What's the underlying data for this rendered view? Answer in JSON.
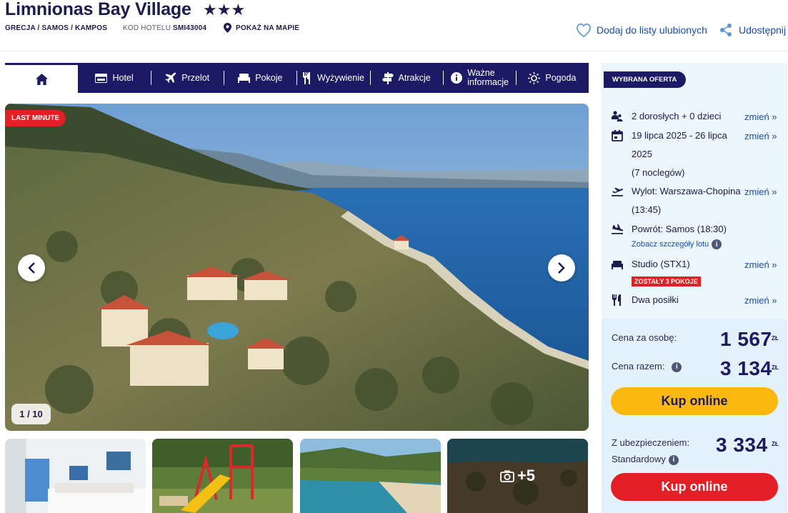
{
  "hotel": {
    "name": "Limnionas Bay Village",
    "stars": "★★★",
    "breadcrumb": "GRECJA / SAMOS / KAMPOS",
    "code_label": "KOD HOTELU",
    "code": "SMI43004",
    "map_link": "POKAŻ NA MAPIE"
  },
  "actions": {
    "favorite": "Dodaj do listy ulubionych",
    "share": "Udostępnij"
  },
  "nav": {
    "items": [
      {
        "label": "Hotel",
        "icon": "hotel-icon"
      },
      {
        "label": "Przelot",
        "icon": "plane-icon"
      },
      {
        "label": "Pokoje",
        "icon": "bed-icon"
      },
      {
        "label": "Wyżywienie",
        "icon": "cutlery-icon"
      },
      {
        "label": "Atrakcje",
        "icon": "signpost-icon"
      },
      {
        "label": "Ważne informacje",
        "icon": "info-icon"
      },
      {
        "label": "Pogoda",
        "icon": "sun-icon"
      }
    ]
  },
  "gallery": {
    "badge": "LAST MINUTE",
    "counter": "1 / 10",
    "more_label": "+5"
  },
  "offer": {
    "chip": "WYBRANA OFERTA",
    "change_label": "zmień »",
    "guests": "2 dorosłych + 0 dzieci",
    "dates": "19 lipca 2025 - 26 lipca 2025",
    "nights": "(7 noclegów)",
    "departure": "Wylot: Warszawa-Chopina (13:45)",
    "return": "Powrót: Samos (18:30)",
    "flight_details": "Zobacz szczegóły lotu",
    "room": "Studio (STX1)",
    "rooms_left": "ZOSTAŁY 3 POKOJE",
    "board": "Dwa posiłki"
  },
  "pricing": {
    "per_person_label": "Cena za osobę:",
    "per_person": "1 567",
    "total_label": "Cena razem:",
    "total": "3 134",
    "currency": "ZŁ",
    "buy": "Kup online",
    "insurance_label_1": "Z ubezpieczeniem:",
    "insurance_label_2": "Standardowy",
    "insurance_total": "3 334",
    "buy_insured": "Kup online"
  },
  "colors": {
    "navy": "#1c1a64",
    "accent_blue": "#1a4ea8",
    "red": "#e31f26",
    "yellow": "#fbb80f"
  }
}
